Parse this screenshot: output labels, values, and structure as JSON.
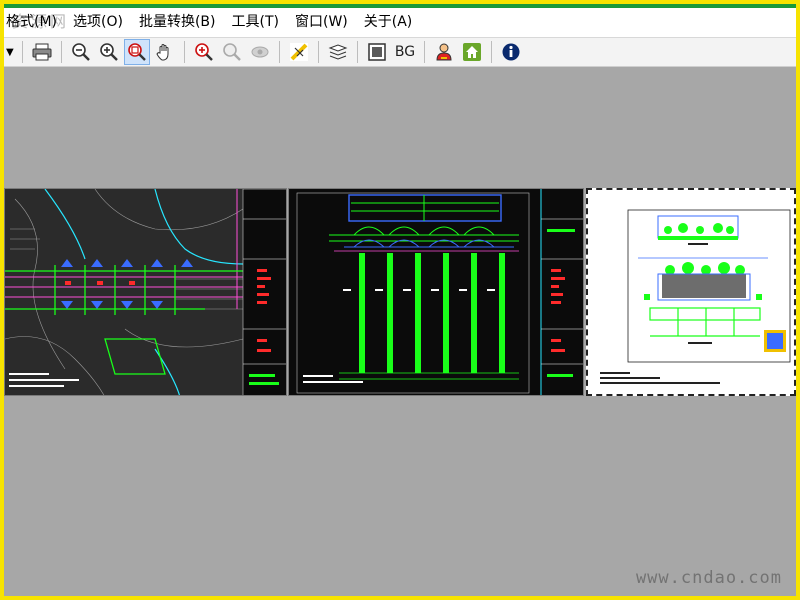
{
  "watermark_top": "资源网",
  "menu": [
    {
      "label": "格式(M)"
    },
    {
      "label": "选项(O)"
    },
    {
      "label": "批量转换(B)"
    },
    {
      "label": "工具(T)"
    },
    {
      "label": "窗口(W)"
    },
    {
      "label": "关于(A)"
    }
  ],
  "toolbar": {
    "bg_label": "BG",
    "items": [
      {
        "icon": "dropdown-arrow-icon"
      },
      {
        "icon": "printer-icon"
      },
      {
        "icon": "zoom-out-icon"
      },
      {
        "icon": "zoom-in-icon"
      },
      {
        "icon": "zoom-window-icon",
        "active": true
      },
      {
        "icon": "pan-hand-icon"
      },
      {
        "icon": "zoom-extents-icon"
      },
      {
        "icon": "zoom-realtime-icon",
        "disabled": true
      },
      {
        "icon": "view-eye-icon",
        "disabled": true
      },
      {
        "icon": "measure-icon"
      },
      {
        "icon": "layers-icon"
      },
      {
        "icon": "layout-icon"
      },
      {
        "icon": "background-toggle-icon"
      },
      {
        "icon": "user-icon"
      },
      {
        "icon": "home-icon"
      },
      {
        "icon": "info-icon"
      }
    ]
  },
  "sheets": [
    {
      "name": "plan-sheet"
    },
    {
      "name": "elevation-sheet"
    },
    {
      "name": "print-preview-sheet"
    }
  ],
  "watermark_bottom": "www.cndao.com",
  "colors": {
    "frame": "#f7e300",
    "top_strip": "#1a9a3a",
    "workspace": "#a7a7a7",
    "cad_bg": "#0b0b0b",
    "cad_green": "#19ff19",
    "cad_blue": "#3a6cff",
    "cad_magenta": "#ff4fd8",
    "cad_red": "#ff2b2b",
    "cad_cyan": "#27e6ff"
  }
}
